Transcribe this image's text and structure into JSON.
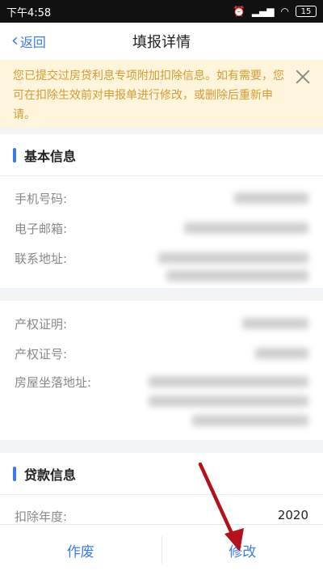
{
  "status_bar": {
    "time": "下午4:58",
    "battery": "15"
  },
  "nav": {
    "back_label": "返回",
    "title": "填报详情"
  },
  "notice": {
    "text": "您已提交过房贷利息专项附加扣除信息。如有需要，您可在扣除生效前对申报单进行修改，或删除后重新申请。"
  },
  "basic_info": {
    "title": "基本信息",
    "fields": [
      {
        "label": "手机号码:"
      },
      {
        "label": "电子邮箱:"
      },
      {
        "label": "联系地址:"
      }
    ]
  },
  "property_info": {
    "fields": [
      {
        "label": "产权证明:"
      },
      {
        "label": "产权证号:"
      },
      {
        "label": "房屋坐落地址:"
      }
    ]
  },
  "loan_info": {
    "title": "贷款信息",
    "deduction_year_label": "扣除年度:",
    "deduction_year_value": "2020"
  },
  "bottom": {
    "void_label": "作废",
    "edit_label": "修改"
  },
  "colors": {
    "accent": "#3b7ae8",
    "notice_bg": "#fef5dc",
    "notice_text": "#d39a33",
    "arrow": "#b3121d"
  }
}
